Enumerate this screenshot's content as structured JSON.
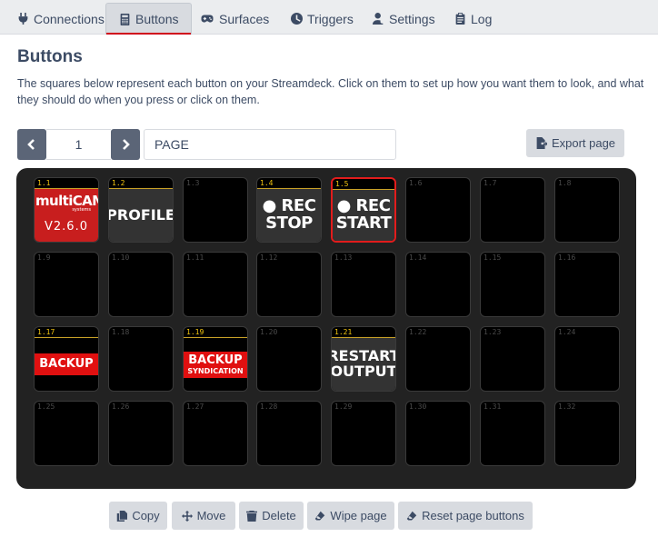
{
  "tabs": [
    {
      "label": "Connections",
      "icon": "plug-icon"
    },
    {
      "label": "Buttons",
      "icon": "calculator-icon"
    },
    {
      "label": "Surfaces",
      "icon": "gamepad-icon"
    },
    {
      "label": "Triggers",
      "icon": "clock-icon"
    },
    {
      "label": "Settings",
      "icon": "user-cog-icon"
    },
    {
      "label": "Log",
      "icon": "clipboard-icon"
    }
  ],
  "active_tab": "Buttons",
  "heading": "Buttons",
  "description": "The squares below represent each button on your Streamdeck. Click on them to set up how you want them to look, and what they should do when you press or click on them.",
  "page": {
    "number": "1",
    "name": "PAGE",
    "export_label": "Export page"
  },
  "colors": {
    "accent": "#d0021b",
    "selected_border": "#e21c1c",
    "label_yellow": "#f1c40f",
    "banner_red": "#e01010"
  },
  "grid": [
    {
      "id": "1.1",
      "kind": "multicam",
      "line1": "multiCAM",
      "line2": "systems",
      "line3": "V2.6.0"
    },
    {
      "id": "1.2",
      "kind": "text",
      "lines": [
        "PROFILE"
      ]
    },
    {
      "id": "1.3"
    },
    {
      "id": "1.4",
      "kind": "text",
      "lines": [
        "● REC",
        "STOP"
      ]
    },
    {
      "id": "1.5",
      "kind": "text",
      "lines": [
        "● REC",
        "START"
      ],
      "selected": true
    },
    {
      "id": "1.6"
    },
    {
      "id": "1.7"
    },
    {
      "id": "1.8"
    },
    {
      "id": "1.9"
    },
    {
      "id": "1.10"
    },
    {
      "id": "1.11"
    },
    {
      "id": "1.12"
    },
    {
      "id": "1.13"
    },
    {
      "id": "1.14"
    },
    {
      "id": "1.15"
    },
    {
      "id": "1.16"
    },
    {
      "id": "1.17",
      "kind": "banner",
      "lines": [
        "BACKUP"
      ]
    },
    {
      "id": "1.18"
    },
    {
      "id": "1.19",
      "kind": "banner",
      "lines": [
        "BACKUP",
        "SYNDICATION"
      ]
    },
    {
      "id": "1.20"
    },
    {
      "id": "1.21",
      "kind": "text",
      "lines": [
        "RESTART",
        "OUTPUT"
      ]
    },
    {
      "id": "1.22"
    },
    {
      "id": "1.23"
    },
    {
      "id": "1.24"
    },
    {
      "id": "1.25"
    },
    {
      "id": "1.26"
    },
    {
      "id": "1.27"
    },
    {
      "id": "1.28"
    },
    {
      "id": "1.29"
    },
    {
      "id": "1.30"
    },
    {
      "id": "1.31"
    },
    {
      "id": "1.32"
    }
  ],
  "actions": [
    {
      "label": "Copy",
      "icon": "copy-icon"
    },
    {
      "label": "Move",
      "icon": "move-icon"
    },
    {
      "label": "Delete",
      "icon": "trash-icon"
    },
    {
      "label": "Wipe page",
      "icon": "eraser-icon"
    },
    {
      "label": "Reset page buttons",
      "icon": "eraser-icon"
    }
  ]
}
